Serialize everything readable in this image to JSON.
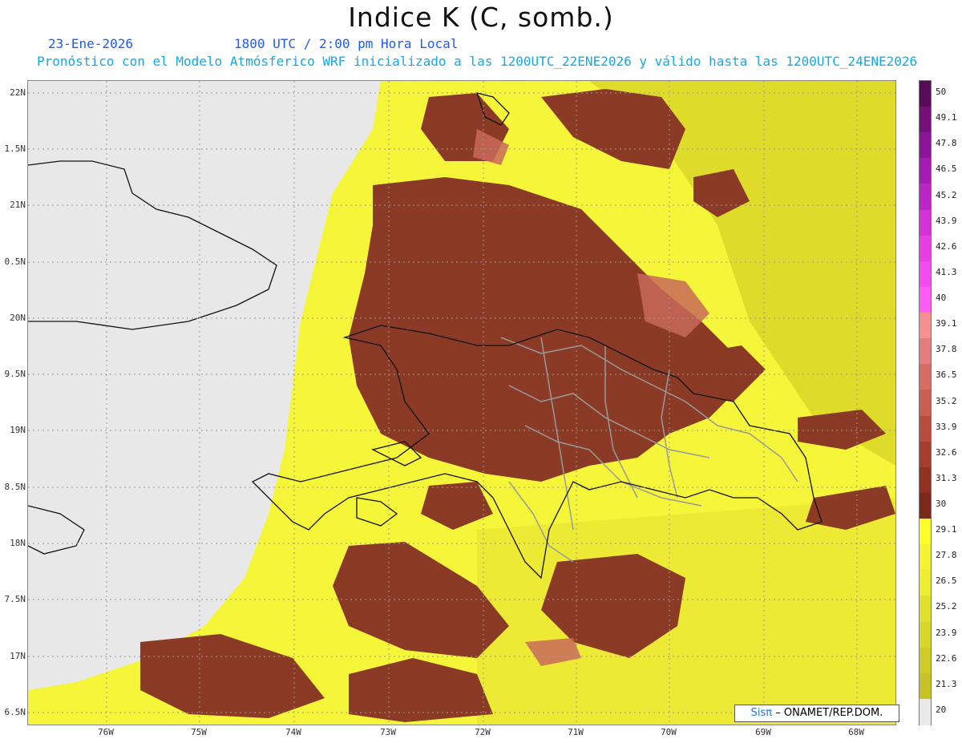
{
  "header": {
    "title": "Indice K (C, somb.)",
    "date": "23-Ene-2026",
    "time": "1800 UTC / 2:00 pm Hora Local",
    "description": "Pronóstico con el Modelo Atmósferico WRF inicializado a las 1200UTC_22ENE2026 y válido hasta las  1200UTC_24ENE2026"
  },
  "map": {
    "lat_labels": [
      "22N",
      "1.5N",
      "21N",
      "0.5N",
      "20N",
      "9.5N",
      "19N",
      "8.5N",
      "18N",
      "7.5N",
      "17N",
      "6.5N"
    ],
    "lon_labels": [
      "76W",
      "75W",
      "74W",
      "73W",
      "72W",
      "71W",
      "70W",
      "69W",
      "68W"
    ],
    "colors": {
      "missing": "#e8e8e8",
      "high_k": "#8b3a26",
      "high_k_light": "#c96a5a",
      "low_k": "#f5f53a",
      "low_k_dark": "#d6d22a",
      "coast": "#111111",
      "province": "#9a9a9a"
    }
  },
  "colorbar": {
    "labels": [
      "50",
      "49.1",
      "47.8",
      "46.5",
      "45.2",
      "43.9",
      "42.6",
      "41.3",
      "40",
      "39.1",
      "37.8",
      "36.5",
      "35.2",
      "33.9",
      "32.6",
      "31.3",
      "30",
      "29.1",
      "27.8",
      "26.5",
      "25.2",
      "23.9",
      "22.6",
      "21.3",
      "20"
    ],
    "colors": [
      "#5a0a5a",
      "#75107a",
      "#8c1496",
      "#a41cb4",
      "#bc26c8",
      "#d432d8",
      "#e83ee4",
      "#f24cf0",
      "#ff5cf6",
      "#f49090",
      "#e47e7e",
      "#d76e66",
      "#c95e52",
      "#b84c3e",
      "#a63e30",
      "#8f3222",
      "#7a2a1a",
      "#fffe2a",
      "#f6f234",
      "#eded32",
      "#e2e02e",
      "#d8d62c",
      "#cfcc2a",
      "#c6c228",
      "#e9e9e9"
    ]
  },
  "credit": {
    "logo": "Sisπ",
    "text": "– ONAMET/REP.DOM."
  }
}
